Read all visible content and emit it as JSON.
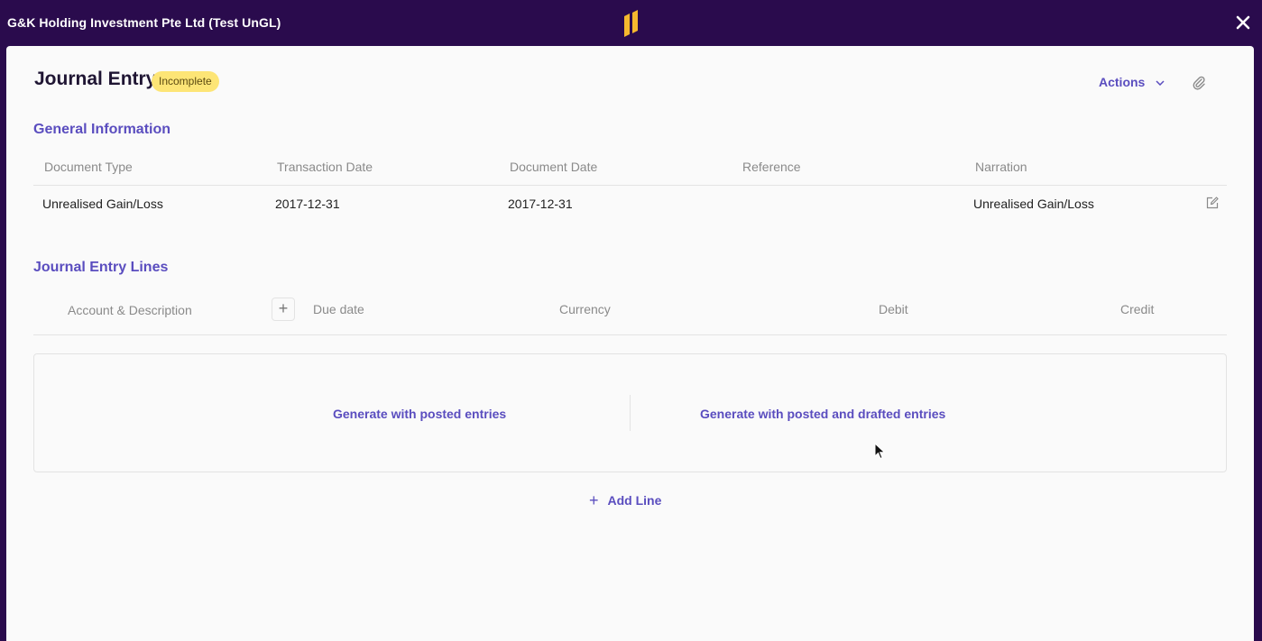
{
  "window": {
    "org_name": "G&K Holding Investment Pte Ltd (Test UnGL)",
    "logo_icon": "brand-logo-icon",
    "close_icon": "close-icon"
  },
  "header": {
    "title": "Journal Entry",
    "status": "Incomplete",
    "actions_label": "Actions"
  },
  "general_info": {
    "title": "General Information",
    "columns": [
      "Document Type",
      "Transaction Date",
      "Document Date",
      "Reference",
      "Narration"
    ],
    "row": {
      "document_type": "Unrealised Gain/Loss",
      "transaction_date": "2017-12-31",
      "document_date": "2017-12-31",
      "reference": "",
      "narration": "Unrealised Gain/Loss"
    }
  },
  "lines": {
    "title": "Journal Entry Lines",
    "columns": {
      "account": "Account & Description",
      "due_date": "Due date",
      "currency": "Currency",
      "debit": "Debit",
      "credit": "Credit"
    },
    "generate_posted": "Generate with posted entries",
    "generate_posted_drafted": "Generate with posted and drafted entries",
    "add_line": "Add Line",
    "add_column_symbol": "+"
  },
  "colors": {
    "topbar": "#2a0b4d",
    "accent": "#5a4dbf",
    "badge": "#fde576",
    "logo": "#f5b82e"
  }
}
